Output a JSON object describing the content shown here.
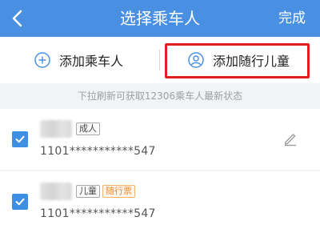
{
  "navbar": {
    "title": "选择乘车人",
    "done_label": "完成"
  },
  "actions": {
    "add_passenger": "添加乘车人",
    "add_child": "添加随行儿童"
  },
  "tip": "下拉刷新可获取12306乘车人最新状态",
  "passengers": [
    {
      "type_tag": "成人",
      "id_number": "1101***********547",
      "checked": true
    },
    {
      "type_tag": "儿童",
      "extra_tag": "随行票",
      "id_number": "1101***********547",
      "checked": true
    }
  ],
  "colors": {
    "brand": "#4a90e2",
    "highlight": "#e0201e",
    "checkbox": "#3d8fe4",
    "accent_tag": "#f08a2e"
  }
}
